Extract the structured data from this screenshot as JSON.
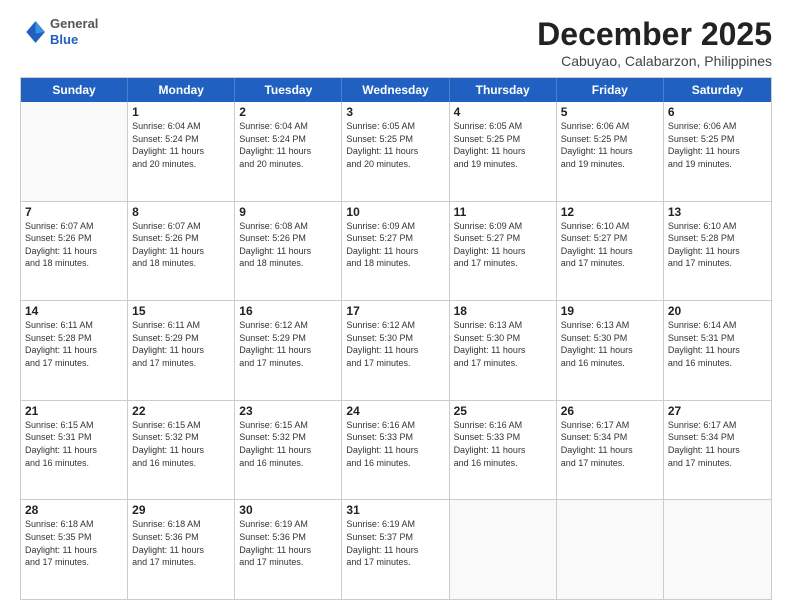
{
  "header": {
    "logo_general": "General",
    "logo_blue": "Blue",
    "title": "December 2025",
    "subtitle": "Cabuyao, Calabarzon, Philippines"
  },
  "calendar": {
    "days_of_week": [
      "Sunday",
      "Monday",
      "Tuesday",
      "Wednesday",
      "Thursday",
      "Friday",
      "Saturday"
    ],
    "rows": [
      [
        {
          "day": "",
          "info": ""
        },
        {
          "day": "1",
          "info": "Sunrise: 6:04 AM\nSunset: 5:24 PM\nDaylight: 11 hours\nand 20 minutes."
        },
        {
          "day": "2",
          "info": "Sunrise: 6:04 AM\nSunset: 5:24 PM\nDaylight: 11 hours\nand 20 minutes."
        },
        {
          "day": "3",
          "info": "Sunrise: 6:05 AM\nSunset: 5:25 PM\nDaylight: 11 hours\nand 20 minutes."
        },
        {
          "day": "4",
          "info": "Sunrise: 6:05 AM\nSunset: 5:25 PM\nDaylight: 11 hours\nand 19 minutes."
        },
        {
          "day": "5",
          "info": "Sunrise: 6:06 AM\nSunset: 5:25 PM\nDaylight: 11 hours\nand 19 minutes."
        },
        {
          "day": "6",
          "info": "Sunrise: 6:06 AM\nSunset: 5:25 PM\nDaylight: 11 hours\nand 19 minutes."
        }
      ],
      [
        {
          "day": "7",
          "info": "Sunrise: 6:07 AM\nSunset: 5:26 PM\nDaylight: 11 hours\nand 18 minutes."
        },
        {
          "day": "8",
          "info": "Sunrise: 6:07 AM\nSunset: 5:26 PM\nDaylight: 11 hours\nand 18 minutes."
        },
        {
          "day": "9",
          "info": "Sunrise: 6:08 AM\nSunset: 5:26 PM\nDaylight: 11 hours\nand 18 minutes."
        },
        {
          "day": "10",
          "info": "Sunrise: 6:09 AM\nSunset: 5:27 PM\nDaylight: 11 hours\nand 18 minutes."
        },
        {
          "day": "11",
          "info": "Sunrise: 6:09 AM\nSunset: 5:27 PM\nDaylight: 11 hours\nand 17 minutes."
        },
        {
          "day": "12",
          "info": "Sunrise: 6:10 AM\nSunset: 5:27 PM\nDaylight: 11 hours\nand 17 minutes."
        },
        {
          "day": "13",
          "info": "Sunrise: 6:10 AM\nSunset: 5:28 PM\nDaylight: 11 hours\nand 17 minutes."
        }
      ],
      [
        {
          "day": "14",
          "info": "Sunrise: 6:11 AM\nSunset: 5:28 PM\nDaylight: 11 hours\nand 17 minutes."
        },
        {
          "day": "15",
          "info": "Sunrise: 6:11 AM\nSunset: 5:29 PM\nDaylight: 11 hours\nand 17 minutes."
        },
        {
          "day": "16",
          "info": "Sunrise: 6:12 AM\nSunset: 5:29 PM\nDaylight: 11 hours\nand 17 minutes."
        },
        {
          "day": "17",
          "info": "Sunrise: 6:12 AM\nSunset: 5:30 PM\nDaylight: 11 hours\nand 17 minutes."
        },
        {
          "day": "18",
          "info": "Sunrise: 6:13 AM\nSunset: 5:30 PM\nDaylight: 11 hours\nand 17 minutes."
        },
        {
          "day": "19",
          "info": "Sunrise: 6:13 AM\nSunset: 5:30 PM\nDaylight: 11 hours\nand 16 minutes."
        },
        {
          "day": "20",
          "info": "Sunrise: 6:14 AM\nSunset: 5:31 PM\nDaylight: 11 hours\nand 16 minutes."
        }
      ],
      [
        {
          "day": "21",
          "info": "Sunrise: 6:15 AM\nSunset: 5:31 PM\nDaylight: 11 hours\nand 16 minutes."
        },
        {
          "day": "22",
          "info": "Sunrise: 6:15 AM\nSunset: 5:32 PM\nDaylight: 11 hours\nand 16 minutes."
        },
        {
          "day": "23",
          "info": "Sunrise: 6:15 AM\nSunset: 5:32 PM\nDaylight: 11 hours\nand 16 minutes."
        },
        {
          "day": "24",
          "info": "Sunrise: 6:16 AM\nSunset: 5:33 PM\nDaylight: 11 hours\nand 16 minutes."
        },
        {
          "day": "25",
          "info": "Sunrise: 6:16 AM\nSunset: 5:33 PM\nDaylight: 11 hours\nand 16 minutes."
        },
        {
          "day": "26",
          "info": "Sunrise: 6:17 AM\nSunset: 5:34 PM\nDaylight: 11 hours\nand 17 minutes."
        },
        {
          "day": "27",
          "info": "Sunrise: 6:17 AM\nSunset: 5:34 PM\nDaylight: 11 hours\nand 17 minutes."
        }
      ],
      [
        {
          "day": "28",
          "info": "Sunrise: 6:18 AM\nSunset: 5:35 PM\nDaylight: 11 hours\nand 17 minutes."
        },
        {
          "day": "29",
          "info": "Sunrise: 6:18 AM\nSunset: 5:36 PM\nDaylight: 11 hours\nand 17 minutes."
        },
        {
          "day": "30",
          "info": "Sunrise: 6:19 AM\nSunset: 5:36 PM\nDaylight: 11 hours\nand 17 minutes."
        },
        {
          "day": "31",
          "info": "Sunrise: 6:19 AM\nSunset: 5:37 PM\nDaylight: 11 hours\nand 17 minutes."
        },
        {
          "day": "",
          "info": ""
        },
        {
          "day": "",
          "info": ""
        },
        {
          "day": "",
          "info": ""
        }
      ]
    ]
  }
}
